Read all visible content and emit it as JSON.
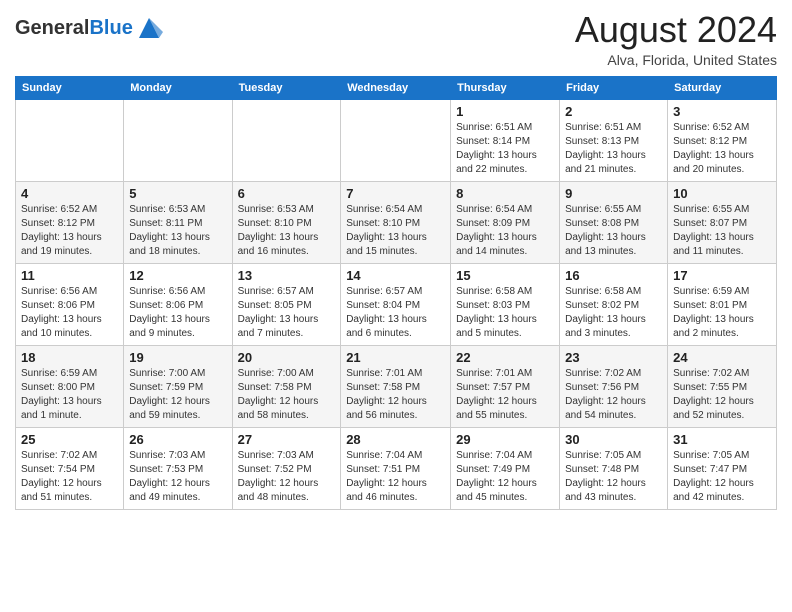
{
  "header": {
    "logo_general": "General",
    "logo_blue": "Blue",
    "main_title": "August 2024",
    "subtitle": "Alva, Florida, United States"
  },
  "days_of_week": [
    "Sunday",
    "Monday",
    "Tuesday",
    "Wednesday",
    "Thursday",
    "Friday",
    "Saturday"
  ],
  "weeks": [
    [
      {
        "day": "",
        "info": ""
      },
      {
        "day": "",
        "info": ""
      },
      {
        "day": "",
        "info": ""
      },
      {
        "day": "",
        "info": ""
      },
      {
        "day": "1",
        "info": "Sunrise: 6:51 AM\nSunset: 8:14 PM\nDaylight: 13 hours and 22 minutes."
      },
      {
        "day": "2",
        "info": "Sunrise: 6:51 AM\nSunset: 8:13 PM\nDaylight: 13 hours and 21 minutes."
      },
      {
        "day": "3",
        "info": "Sunrise: 6:52 AM\nSunset: 8:12 PM\nDaylight: 13 hours and 20 minutes."
      }
    ],
    [
      {
        "day": "4",
        "info": "Sunrise: 6:52 AM\nSunset: 8:12 PM\nDaylight: 13 hours and 19 minutes."
      },
      {
        "day": "5",
        "info": "Sunrise: 6:53 AM\nSunset: 8:11 PM\nDaylight: 13 hours and 18 minutes."
      },
      {
        "day": "6",
        "info": "Sunrise: 6:53 AM\nSunset: 8:10 PM\nDaylight: 13 hours and 16 minutes."
      },
      {
        "day": "7",
        "info": "Sunrise: 6:54 AM\nSunset: 8:10 PM\nDaylight: 13 hours and 15 minutes."
      },
      {
        "day": "8",
        "info": "Sunrise: 6:54 AM\nSunset: 8:09 PM\nDaylight: 13 hours and 14 minutes."
      },
      {
        "day": "9",
        "info": "Sunrise: 6:55 AM\nSunset: 8:08 PM\nDaylight: 13 hours and 13 minutes."
      },
      {
        "day": "10",
        "info": "Sunrise: 6:55 AM\nSunset: 8:07 PM\nDaylight: 13 hours and 11 minutes."
      }
    ],
    [
      {
        "day": "11",
        "info": "Sunrise: 6:56 AM\nSunset: 8:06 PM\nDaylight: 13 hours and 10 minutes."
      },
      {
        "day": "12",
        "info": "Sunrise: 6:56 AM\nSunset: 8:06 PM\nDaylight: 13 hours and 9 minutes."
      },
      {
        "day": "13",
        "info": "Sunrise: 6:57 AM\nSunset: 8:05 PM\nDaylight: 13 hours and 7 minutes."
      },
      {
        "day": "14",
        "info": "Sunrise: 6:57 AM\nSunset: 8:04 PM\nDaylight: 13 hours and 6 minutes."
      },
      {
        "day": "15",
        "info": "Sunrise: 6:58 AM\nSunset: 8:03 PM\nDaylight: 13 hours and 5 minutes."
      },
      {
        "day": "16",
        "info": "Sunrise: 6:58 AM\nSunset: 8:02 PM\nDaylight: 13 hours and 3 minutes."
      },
      {
        "day": "17",
        "info": "Sunrise: 6:59 AM\nSunset: 8:01 PM\nDaylight: 13 hours and 2 minutes."
      }
    ],
    [
      {
        "day": "18",
        "info": "Sunrise: 6:59 AM\nSunset: 8:00 PM\nDaylight: 13 hours and 1 minute."
      },
      {
        "day": "19",
        "info": "Sunrise: 7:00 AM\nSunset: 7:59 PM\nDaylight: 12 hours and 59 minutes."
      },
      {
        "day": "20",
        "info": "Sunrise: 7:00 AM\nSunset: 7:58 PM\nDaylight: 12 hours and 58 minutes."
      },
      {
        "day": "21",
        "info": "Sunrise: 7:01 AM\nSunset: 7:58 PM\nDaylight: 12 hours and 56 minutes."
      },
      {
        "day": "22",
        "info": "Sunrise: 7:01 AM\nSunset: 7:57 PM\nDaylight: 12 hours and 55 minutes."
      },
      {
        "day": "23",
        "info": "Sunrise: 7:02 AM\nSunset: 7:56 PM\nDaylight: 12 hours and 54 minutes."
      },
      {
        "day": "24",
        "info": "Sunrise: 7:02 AM\nSunset: 7:55 PM\nDaylight: 12 hours and 52 minutes."
      }
    ],
    [
      {
        "day": "25",
        "info": "Sunrise: 7:02 AM\nSunset: 7:54 PM\nDaylight: 12 hours and 51 minutes."
      },
      {
        "day": "26",
        "info": "Sunrise: 7:03 AM\nSunset: 7:53 PM\nDaylight: 12 hours and 49 minutes."
      },
      {
        "day": "27",
        "info": "Sunrise: 7:03 AM\nSunset: 7:52 PM\nDaylight: 12 hours and 48 minutes."
      },
      {
        "day": "28",
        "info": "Sunrise: 7:04 AM\nSunset: 7:51 PM\nDaylight: 12 hours and 46 minutes."
      },
      {
        "day": "29",
        "info": "Sunrise: 7:04 AM\nSunset: 7:49 PM\nDaylight: 12 hours and 45 minutes."
      },
      {
        "day": "30",
        "info": "Sunrise: 7:05 AM\nSunset: 7:48 PM\nDaylight: 12 hours and 43 minutes."
      },
      {
        "day": "31",
        "info": "Sunrise: 7:05 AM\nSunset: 7:47 PM\nDaylight: 12 hours and 42 minutes."
      }
    ]
  ]
}
